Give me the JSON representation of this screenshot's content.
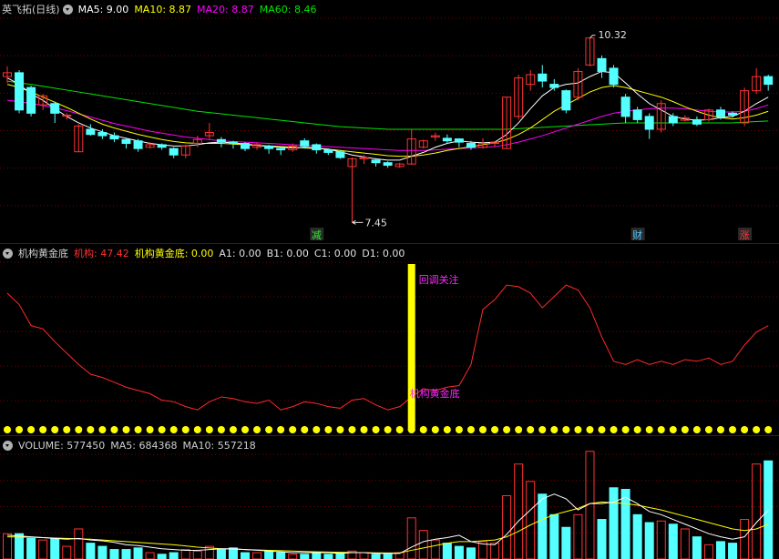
{
  "colors": {
    "up": "#ff3232",
    "down": "#54ffff",
    "ma5": "#ffffff",
    "ma10": "#ffff00",
    "ma20": "#ff00ff",
    "ma60": "#00e600",
    "grid": "#7a0000",
    "line": "#ff2a2a",
    "yellow": "#ffff00",
    "magenta": "#ff28ff",
    "label": "#cfcfcf",
    "annot": "#e0e0e0"
  },
  "main": {
    "title": "英飞拓(日线)",
    "ma5": "MA5: 9.00",
    "ma10": "MA10: 8.87",
    "ma20": "MA20: 8.87",
    "ma60": "MA60: 8.46",
    "high_label": "10.32",
    "low_label": "7.45",
    "markers": [
      "减",
      "财",
      "涨"
    ]
  },
  "indicator": {
    "title": "机构黄金底",
    "jg_label": "机构: 47.42",
    "gold_label": "机构黄金底: 0.00",
    "a1": "A1: 0.00",
    "b1": "B1: 0.00",
    "c1": "C1: 0.00",
    "d1": "D1: 0.00",
    "annot_top": "回调关注",
    "annot_mid": "机构黄金底"
  },
  "volume": {
    "title": "VOLUME: 577450",
    "ma5": "MA5: 684368",
    "ma10": "MA10: 557218"
  },
  "chart_data": {
    "type": "candlestick",
    "price_range": [
      7.2,
      10.6
    ],
    "candles": [
      [
        9.72,
        9.78,
        9.62,
        9.88
      ],
      [
        9.78,
        9.2,
        9.15,
        9.82
      ],
      [
        9.55,
        9.15,
        9.1,
        9.58
      ],
      [
        9.28,
        9.42,
        9.2,
        9.45
      ],
      [
        9.3,
        9.15,
        9.0,
        9.33
      ],
      [
        9.12,
        9.12,
        9.05,
        9.15
      ],
      [
        8.55,
        8.95,
        8.55,
        8.98
      ],
      [
        8.9,
        8.82,
        8.8,
        8.98
      ],
      [
        8.85,
        8.8,
        8.75,
        8.9
      ],
      [
        8.8,
        8.75,
        8.7,
        8.85
      ],
      [
        8.74,
        8.68,
        8.6,
        8.76
      ],
      [
        8.72,
        8.6,
        8.55,
        8.75
      ],
      [
        8.62,
        8.66,
        8.6,
        8.7
      ],
      [
        8.66,
        8.62,
        8.58,
        8.68
      ],
      [
        8.6,
        8.5,
        8.45,
        8.62
      ],
      [
        8.5,
        8.64,
        8.45,
        8.66
      ],
      [
        8.68,
        8.74,
        8.62,
        8.8
      ],
      [
        8.8,
        8.85,
        8.75,
        9.0
      ],
      [
        8.74,
        8.7,
        8.62,
        8.78
      ],
      [
        8.7,
        8.68,
        8.6,
        8.72
      ],
      [
        8.68,
        8.6,
        8.56,
        8.7
      ],
      [
        8.62,
        8.66,
        8.58,
        8.7
      ],
      [
        8.64,
        8.6,
        8.52,
        8.66
      ],
      [
        8.6,
        8.58,
        8.5,
        8.62
      ],
      [
        8.58,
        8.64,
        8.55,
        8.68
      ],
      [
        8.72,
        8.64,
        8.6,
        8.76
      ],
      [
        8.66,
        8.58,
        8.52,
        8.68
      ],
      [
        8.58,
        8.54,
        8.5,
        8.6
      ],
      [
        8.55,
        8.46,
        8.44,
        8.58
      ],
      [
        8.32,
        8.44,
        7.45,
        8.46
      ],
      [
        8.44,
        8.46,
        8.36,
        8.5
      ],
      [
        8.42,
        8.38,
        8.32,
        8.45
      ],
      [
        8.38,
        8.34,
        8.3,
        8.4
      ],
      [
        8.32,
        8.36,
        8.3,
        8.38
      ],
      [
        8.36,
        8.75,
        8.35,
        8.9
      ],
      [
        8.62,
        8.72,
        8.6,
        8.74
      ],
      [
        8.78,
        8.8,
        8.72,
        8.85
      ],
      [
        8.76,
        8.72,
        8.68,
        8.82
      ],
      [
        8.75,
        8.7,
        8.62,
        8.76
      ],
      [
        8.68,
        8.62,
        8.58,
        8.72
      ],
      [
        8.62,
        8.68,
        8.6,
        8.76
      ],
      [
        8.68,
        8.7,
        8.62,
        8.72
      ],
      [
        8.6,
        9.4,
        8.6,
        9.4
      ],
      [
        9.1,
        9.7,
        9.05,
        9.75
      ],
      [
        9.6,
        9.75,
        9.5,
        9.82
      ],
      [
        9.76,
        9.65,
        9.55,
        9.9
      ],
      [
        9.6,
        9.55,
        9.5,
        9.68
      ],
      [
        9.5,
        9.2,
        9.15,
        9.52
      ],
      [
        9.4,
        9.8,
        9.35,
        9.85
      ],
      [
        9.9,
        10.32,
        9.88,
        10.32
      ],
      [
        10.0,
        9.8,
        9.7,
        10.05
      ],
      [
        9.85,
        9.6,
        9.55,
        9.9
      ],
      [
        9.4,
        9.1,
        9.0,
        9.45
      ],
      [
        9.2,
        9.05,
        9.0,
        9.25
      ],
      [
        9.1,
        8.9,
        8.75,
        9.15
      ],
      [
        8.9,
        9.3,
        8.85,
        9.35
      ],
      [
        9.1,
        9.0,
        8.95,
        9.15
      ],
      [
        9.04,
        9.08,
        9.02,
        9.12
      ],
      [
        9.05,
        8.98,
        8.95,
        9.1
      ],
      [
        9.05,
        9.2,
        9.02,
        9.22
      ],
      [
        9.2,
        9.1,
        9.05,
        9.25
      ],
      [
        9.15,
        9.12,
        9.08,
        9.18
      ],
      [
        9.0,
        9.5,
        8.95,
        9.55
      ],
      [
        9.5,
        9.72,
        9.45,
        9.85
      ],
      [
        9.72,
        9.6,
        9.5,
        9.75
      ]
    ],
    "ma5": [
      9.7,
      9.6,
      9.45,
      9.35,
      9.22,
      9.1,
      9.0,
      8.92,
      8.86,
      8.8,
      8.76,
      8.72,
      8.68,
      8.66,
      8.64,
      8.64,
      8.66,
      8.69,
      8.7,
      8.69,
      8.67,
      8.65,
      8.63,
      8.62,
      8.61,
      8.62,
      8.61,
      8.59,
      8.55,
      8.5,
      8.47,
      8.44,
      8.42,
      8.42,
      8.48,
      8.54,
      8.62,
      8.68,
      8.72,
      8.7,
      8.69,
      8.7,
      8.82,
      9.0,
      9.22,
      9.42,
      9.55,
      9.6,
      9.62,
      9.72,
      9.8,
      9.78,
      9.62,
      9.45,
      9.3,
      9.2,
      9.1,
      9.06,
      9.04,
      9.05,
      9.08,
      9.1,
      9.18,
      9.3,
      9.4
    ],
    "ma10": [
      9.6,
      9.55,
      9.48,
      9.4,
      9.32,
      9.24,
      9.15,
      9.06,
      8.98,
      8.92,
      8.87,
      8.82,
      8.78,
      8.74,
      8.71,
      8.69,
      8.68,
      8.68,
      8.68,
      8.67,
      8.66,
      8.65,
      8.64,
      8.63,
      8.62,
      8.61,
      8.6,
      8.59,
      8.57,
      8.55,
      8.53,
      8.51,
      8.49,
      8.48,
      8.48,
      8.5,
      8.53,
      8.57,
      8.6,
      8.63,
      8.66,
      8.69,
      8.74,
      8.82,
      8.92,
      9.05,
      9.18,
      9.28,
      9.38,
      9.48,
      9.55,
      9.58,
      9.55,
      9.5,
      9.45,
      9.4,
      9.33,
      9.25,
      9.18,
      9.12,
      9.08,
      9.06,
      9.08,
      9.12,
      9.18
    ],
    "ma20": [
      9.35,
      9.33,
      9.3,
      9.27,
      9.23,
      9.19,
      9.14,
      9.09,
      9.04,
      8.99,
      8.95,
      8.91,
      8.87,
      8.84,
      8.81,
      8.78,
      8.76,
      8.74,
      8.72,
      8.71,
      8.7,
      8.69,
      8.68,
      8.67,
      8.66,
      8.65,
      8.64,
      8.63,
      8.62,
      8.61,
      8.6,
      8.59,
      8.58,
      8.57,
      8.57,
      8.57,
      8.58,
      8.59,
      8.6,
      8.61,
      8.62,
      8.63,
      8.66,
      8.7,
      8.75,
      8.8,
      8.86,
      8.92,
      8.98,
      9.04,
      9.1,
      9.15,
      9.18,
      9.2,
      9.22,
      9.23,
      9.23,
      9.22,
      9.2,
      9.18,
      9.17,
      9.17,
      9.18,
      9.22,
      9.28
    ],
    "ma60": [
      9.65,
      9.62,
      9.6,
      9.57,
      9.54,
      9.51,
      9.48,
      9.45,
      9.42,
      9.39,
      9.36,
      9.33,
      9.3,
      9.27,
      9.24,
      9.21,
      9.18,
      9.16,
      9.14,
      9.12,
      9.1,
      9.08,
      9.06,
      9.04,
      9.02,
      9.0,
      8.98,
      8.96,
      8.94,
      8.93,
      8.92,
      8.91,
      8.9,
      8.9,
      8.9,
      8.9,
      8.9,
      8.9,
      8.9,
      8.9,
      8.9,
      8.9,
      8.9,
      8.91,
      8.92,
      8.93,
      8.94,
      8.95,
      8.96,
      8.97,
      8.98,
      8.99,
      9.0,
      9.0,
      9.0,
      9.0,
      9.0,
      9.0,
      9.0,
      9.0,
      9.0,
      9.0,
      9.01,
      9.02,
      9.03
    ],
    "indicator_range": [
      0,
      100
    ],
    "jg_line": [
      82,
      75,
      62,
      60,
      52,
      45,
      38,
      32,
      30,
      27,
      24,
      22,
      20,
      16,
      15,
      12,
      10,
      15,
      18,
      17,
      15,
      14,
      16,
      10,
      12,
      15,
      14,
      12,
      11,
      16,
      17,
      13,
      10,
      12,
      18,
      23,
      22,
      24,
      25,
      38,
      72,
      78,
      87,
      86,
      82,
      73,
      80,
      87,
      84,
      73,
      55,
      40,
      38,
      41,
      38,
      40,
      38,
      41,
      40,
      42,
      38,
      40,
      50,
      58,
      62
    ],
    "gold_bar_index": 34,
    "gold_bar_value": 100,
    "volume_range": [
      0,
      1300000
    ],
    "volume": [
      320000,
      320000,
      260000,
      240000,
      260000,
      160000,
      380000,
      200000,
      160000,
      120000,
      120000,
      140000,
      80000,
      60000,
      80000,
      120000,
      100000,
      160000,
      120000,
      140000,
      80000,
      80000,
      100000,
      80000,
      60000,
      60000,
      80000,
      60000,
      80000,
      100000,
      80000,
      60000,
      60000,
      80000,
      520000,
      360000,
      240000,
      200000,
      160000,
      140000,
      220000,
      200000,
      800000,
      1200000,
      980000,
      820000,
      560000,
      400000,
      560000,
      1360000,
      500000,
      900000,
      880000,
      560000,
      460000,
      480000,
      440000,
      380000,
      280000,
      180000,
      220000,
      200000,
      500000,
      1200000,
      1240000
    ],
    "vol_ma5": [
      300000,
      290000,
      280000,
      270000,
      260000,
      250000,
      260000,
      240000,
      230000,
      210000,
      180000,
      170000,
      150000,
      130000,
      120000,
      110000,
      110000,
      120000,
      130000,
      130000,
      120000,
      110000,
      100000,
      90000,
      80000,
      80000,
      80000,
      80000,
      70000,
      80000,
      80000,
      70000,
      70000,
      70000,
      150000,
      220000,
      250000,
      270000,
      300000,
      220000,
      190000,
      180000,
      310000,
      480000,
      620000,
      760000,
      820000,
      760000,
      620000,
      700000,
      700000,
      720000,
      780000,
      700000,
      600000,
      560000,
      500000,
      440000,
      380000,
      320000,
      280000,
      250000,
      280000,
      460000,
      620000
    ],
    "vol_ma10": [
      280000,
      278000,
      275000,
      270000,
      265000,
      260000,
      255000,
      250000,
      240000,
      230000,
      220000,
      210000,
      200000,
      190000,
      180000,
      165000,
      150000,
      140000,
      130000,
      125000,
      120000,
      115000,
      110000,
      105000,
      100000,
      95000,
      90000,
      88000,
      85000,
      82000,
      80000,
      78000,
      76000,
      78000,
      110000,
      140000,
      170000,
      200000,
      220000,
      220000,
      230000,
      240000,
      280000,
      350000,
      430000,
      500000,
      560000,
      600000,
      640000,
      700000,
      720000,
      710000,
      700000,
      680000,
      650000,
      620000,
      580000,
      540000,
      500000,
      460000,
      420000,
      380000,
      360000,
      380000,
      440000
    ]
  }
}
